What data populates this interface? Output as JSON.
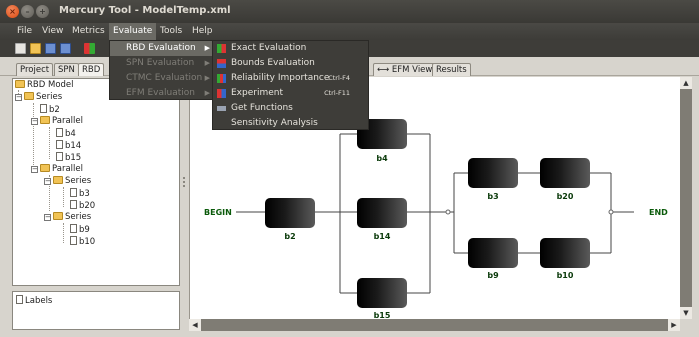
{
  "window": {
    "title": "Mercury Tool - ModelTemp.xml"
  },
  "menubar": [
    "File",
    "View",
    "Metrics",
    "Evaluate",
    "Tools",
    "Help"
  ],
  "evaluate_menu": [
    {
      "label": "RBD Evaluation",
      "enabled": true
    },
    {
      "label": "SPN Evaluation",
      "enabled": false
    },
    {
      "label": "CTMC Evaluation",
      "enabled": false
    },
    {
      "label": "EFM Evaluation",
      "enabled": false
    }
  ],
  "rbd_submenu": [
    {
      "label": "Exact Evaluation",
      "shortcut": "",
      "icon": "grid-icon"
    },
    {
      "label": "Bounds Evaluation",
      "shortcut": "",
      "icon": "bounds-icon"
    },
    {
      "label": "Reliability Importance",
      "shortcut": "Ctrl-F4",
      "icon": "importance-icon"
    },
    {
      "label": "Experiment",
      "shortcut": "Ctrl-F11",
      "icon": "experiment-icon"
    },
    {
      "label": "Get Functions",
      "shortcut": "",
      "icon": "functions-icon"
    },
    {
      "label": "Sensitivity Analysis",
      "shortcut": "",
      "icon": ""
    }
  ],
  "tabs": [
    "Project",
    "SPN",
    "RBD",
    "EFM View",
    "Results"
  ],
  "tree": {
    "root": "RBD Model",
    "nodes": [
      "Series",
      "b2",
      "Parallel",
      "b4",
      "b14",
      "b15",
      "Parallel",
      "Series",
      "b3",
      "b20",
      "Series",
      "b9",
      "b10"
    ]
  },
  "labels_panel": "Labels",
  "diagram": {
    "begin": "BEGIN",
    "end": "END",
    "blocks": [
      "b2",
      "b4",
      "b14",
      "b15",
      "b3",
      "b20",
      "b9",
      "b10"
    ]
  },
  "colors": {
    "block_label": "#0a3a0a",
    "menu_bg": "#3e3d39"
  }
}
